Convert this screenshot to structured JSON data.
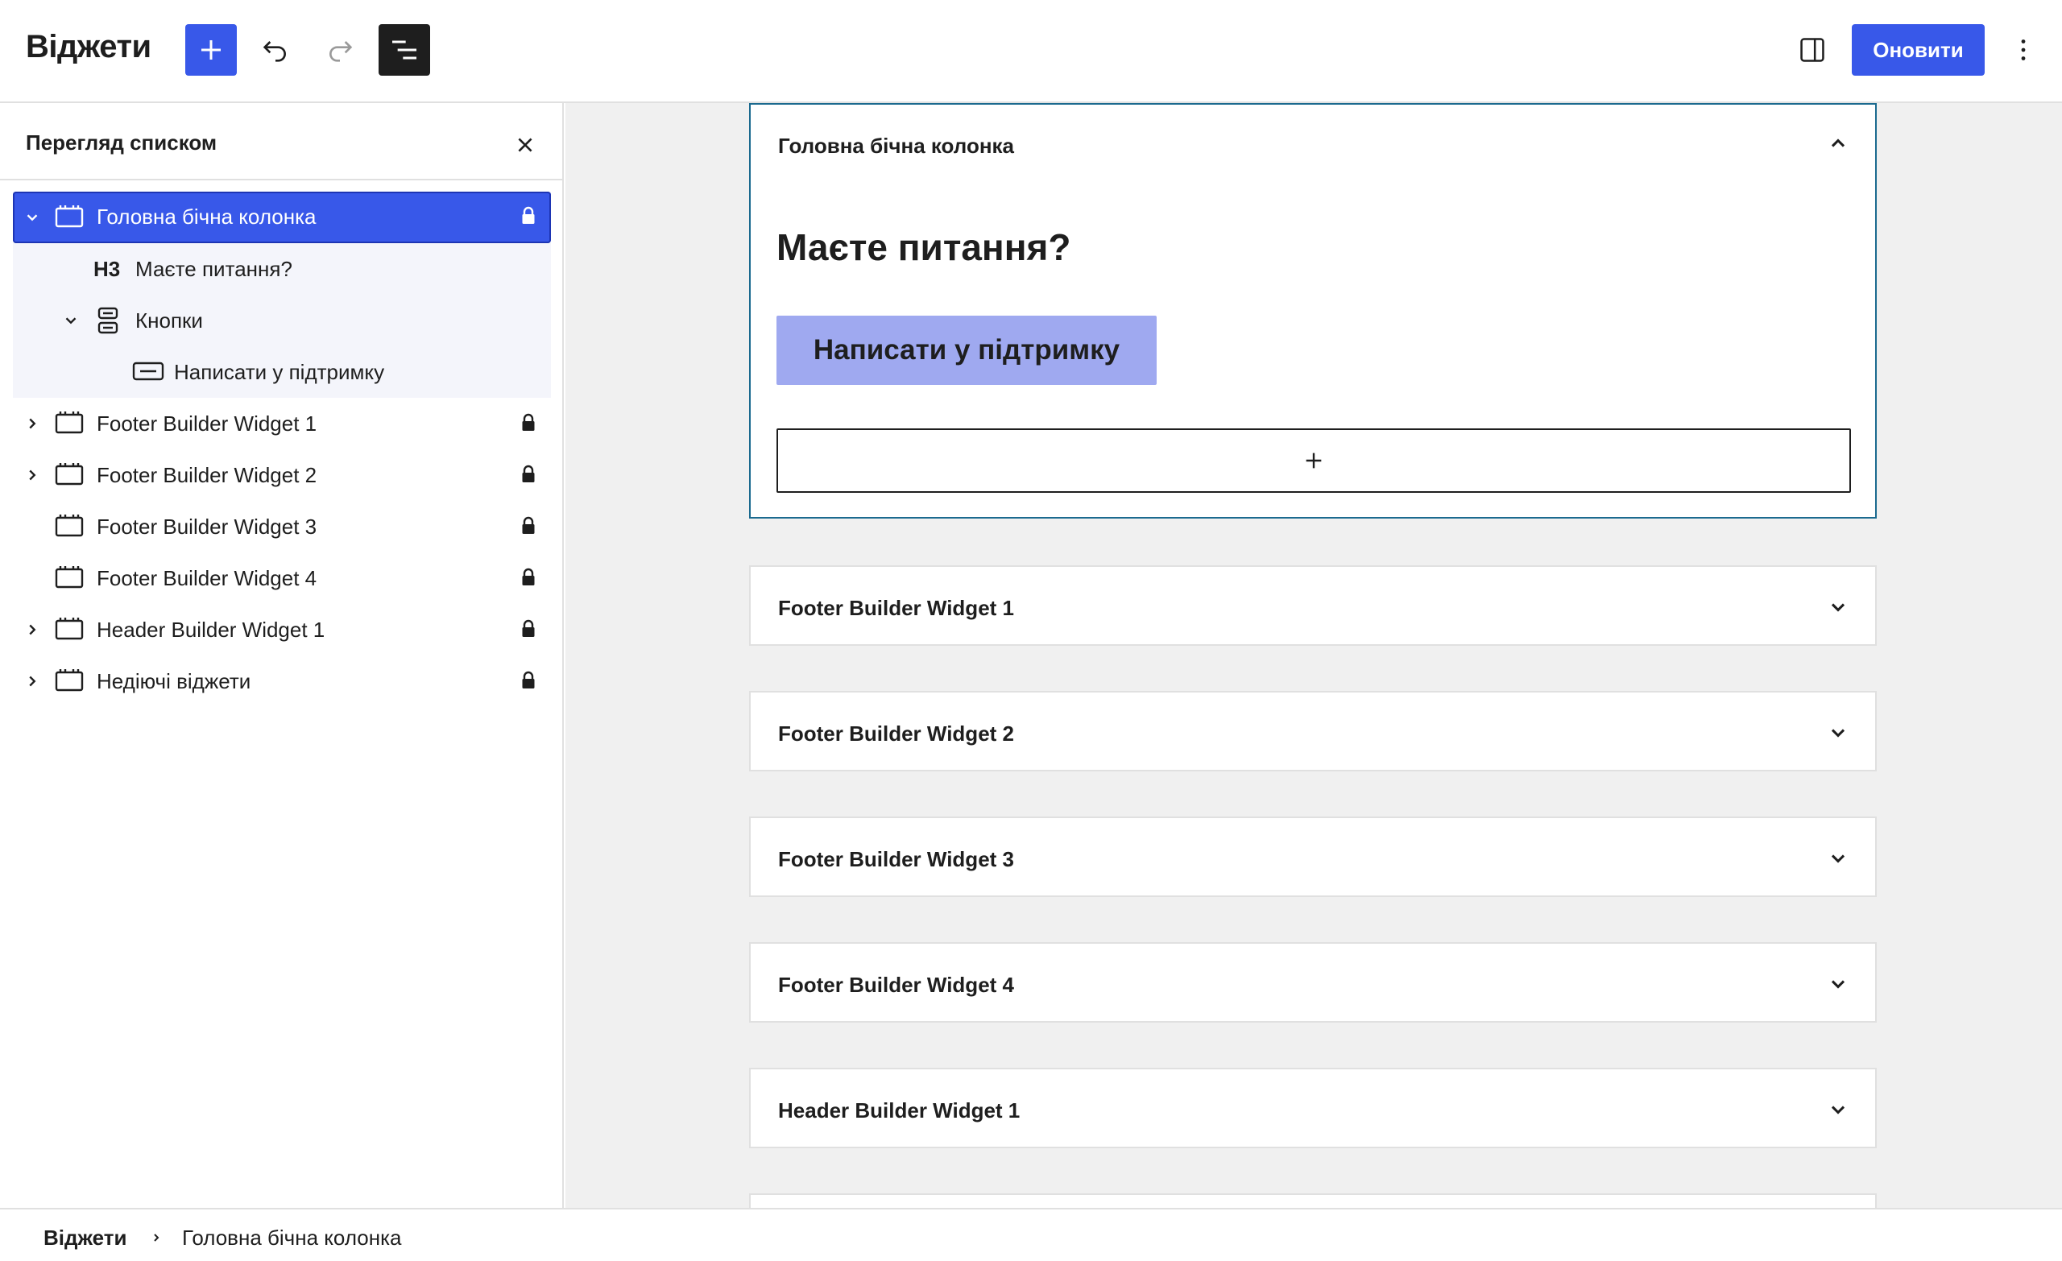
{
  "header": {
    "title": "Віджети",
    "update_label": "Оновити",
    "icons": {
      "add": "plus-icon",
      "undo": "undo-icon",
      "redo": "redo-icon",
      "list_view": "list-view-icon",
      "settings": "sidebar-toggle-icon",
      "more": "more-vertical-icon"
    },
    "accent_color": "#3858e9"
  },
  "sidebar": {
    "title": "Перегляд списком",
    "items": [
      {
        "label": "Головна бічна колонка",
        "selected": true,
        "expanded": true,
        "locked": true
      },
      {
        "tag": "H3",
        "label": "Маєте питання?"
      },
      {
        "label": "Кнопки",
        "expanded": true
      },
      {
        "label": "Написати у підтримку"
      },
      {
        "label": "Footer Builder Widget 1",
        "locked": true
      },
      {
        "label": "Footer Builder Widget 2",
        "locked": true
      },
      {
        "label": "Footer Builder Widget 3",
        "locked": true
      },
      {
        "label": "Footer Builder Widget 4",
        "locked": true
      },
      {
        "label": "Header Builder Widget 1",
        "locked": true
      },
      {
        "label": "Недіючі віджети",
        "locked": true
      }
    ]
  },
  "canvas": {
    "open_area": {
      "title": "Головна бічна колонка",
      "heading": "Маєте питання?",
      "button_label": "Написати у підтримку"
    },
    "areas": [
      {
        "title": "Footer Builder Widget 1"
      },
      {
        "title": "Footer Builder Widget 2"
      },
      {
        "title": "Footer Builder Widget 3"
      },
      {
        "title": "Footer Builder Widget 4"
      },
      {
        "title": "Header Builder Widget 1"
      }
    ]
  },
  "breadcrumb": {
    "root": "Віджети",
    "current": "Головна бічна колонка"
  }
}
